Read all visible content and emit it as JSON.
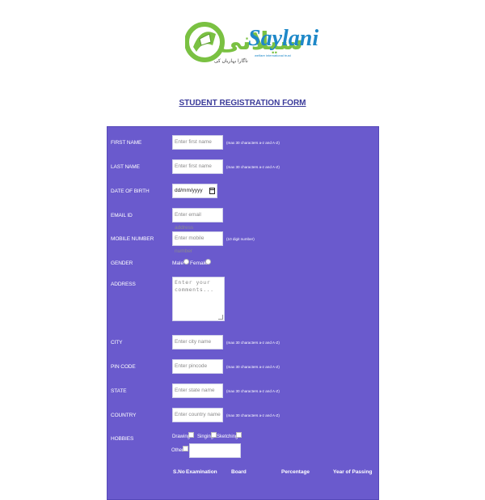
{
  "logo": {
    "urdu_text": "سیلانی",
    "brand_text": "Saylani",
    "sub_text": "welfare international trust",
    "tagline": "ناگارا بہاریاں کی"
  },
  "form_title": "STUDENT REGISTRATION FORM",
  "fields": {
    "first_name": {
      "label": "FIRST NAME",
      "placeholder": "Enter first name",
      "note": "(max 30 characters a-z and A-Z)"
    },
    "last_name": {
      "label": "LAST NAME",
      "placeholder": "Enter first name",
      "note": "(max 30 characters a-z and A-Z)"
    },
    "dob": {
      "label": "DATE OF BIRTH",
      "value": "dd/mm/yyyy"
    },
    "email": {
      "label": "EMAIL ID",
      "placeholder": "Enter email address"
    },
    "mobile": {
      "label": "MOBILE NUMBER",
      "placeholder": "Enter mobile number",
      "note": "(10 digit number)"
    },
    "gender": {
      "label": "GENDER",
      "options": [
        "Male",
        "Female"
      ]
    },
    "address": {
      "label": "ADDRESS",
      "placeholder": "Enter your comments..."
    },
    "city": {
      "label": "CITY",
      "placeholder": "Enter city name",
      "note": "(max 30 characters a-z and A-Z)"
    },
    "pin": {
      "label": "PIN CODE",
      "placeholder": "Enter pincode",
      "note": "(max 30 characters a-z and A-Z)"
    },
    "state": {
      "label": "STATE",
      "placeholder": "Enter state name",
      "note": "(max 30 characters a-z and A-Z)"
    },
    "country": {
      "label": "COUNTRY",
      "placeholder": "Enter country name",
      "note": "(max 30 characters a-z and A-Z)"
    },
    "hobbies": {
      "label": "HOBBIES",
      "options": [
        "Drawing",
        "Singing",
        "Sketching",
        "Other"
      ]
    }
  },
  "qualification_table": {
    "headers": [
      "S.No",
      "Examination",
      "Board",
      "Percentage",
      "Year of Passing"
    ]
  },
  "colors": {
    "panel_bg": "#6a5acd",
    "title": "#3a3a9a",
    "brand_blue": "#1e88c8",
    "brand_green": "#7ac142"
  }
}
